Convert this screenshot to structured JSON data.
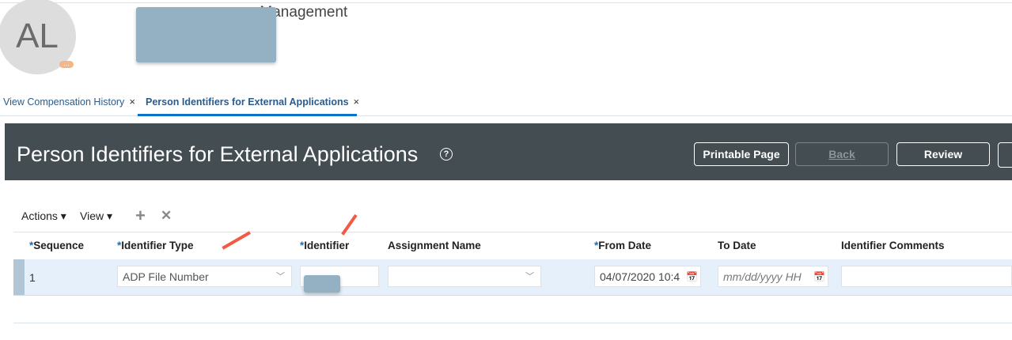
{
  "profile": {
    "initials": "AL",
    "more": "...",
    "title": "on Management"
  },
  "tabs": [
    {
      "label": "View Compensation History",
      "close": "×"
    },
    {
      "label": "Person Identifiers for External Applications",
      "close": "×"
    }
  ],
  "header": {
    "title": "Person Identifiers for External Applications",
    "help": "?",
    "buttons": {
      "printable": "Printable Page",
      "back": "Back",
      "review": "Review"
    }
  },
  "toolbar": {
    "actions": "Actions ▾",
    "view": "View ▾",
    "add": "+",
    "delete": "✕"
  },
  "table": {
    "required_mark": "*",
    "columns": [
      "Sequence",
      "Identifier Type",
      "Identifier",
      "Assignment Name",
      "From Date",
      "To Date",
      "Identifier Comments"
    ],
    "rows": [
      {
        "sequence": "1",
        "identifier_type": "ADP File Number",
        "identifier": "",
        "assignment_name": "",
        "from_date": "04/07/2020 10:4",
        "to_date_placeholder": "mm/dd/yyyy HH",
        "comments": ""
      }
    ]
  },
  "colors": {
    "accent": "#0c72c9",
    "header_bg": "#434d52",
    "annotation": "#f25a45",
    "redaction": "#93b1c3"
  }
}
